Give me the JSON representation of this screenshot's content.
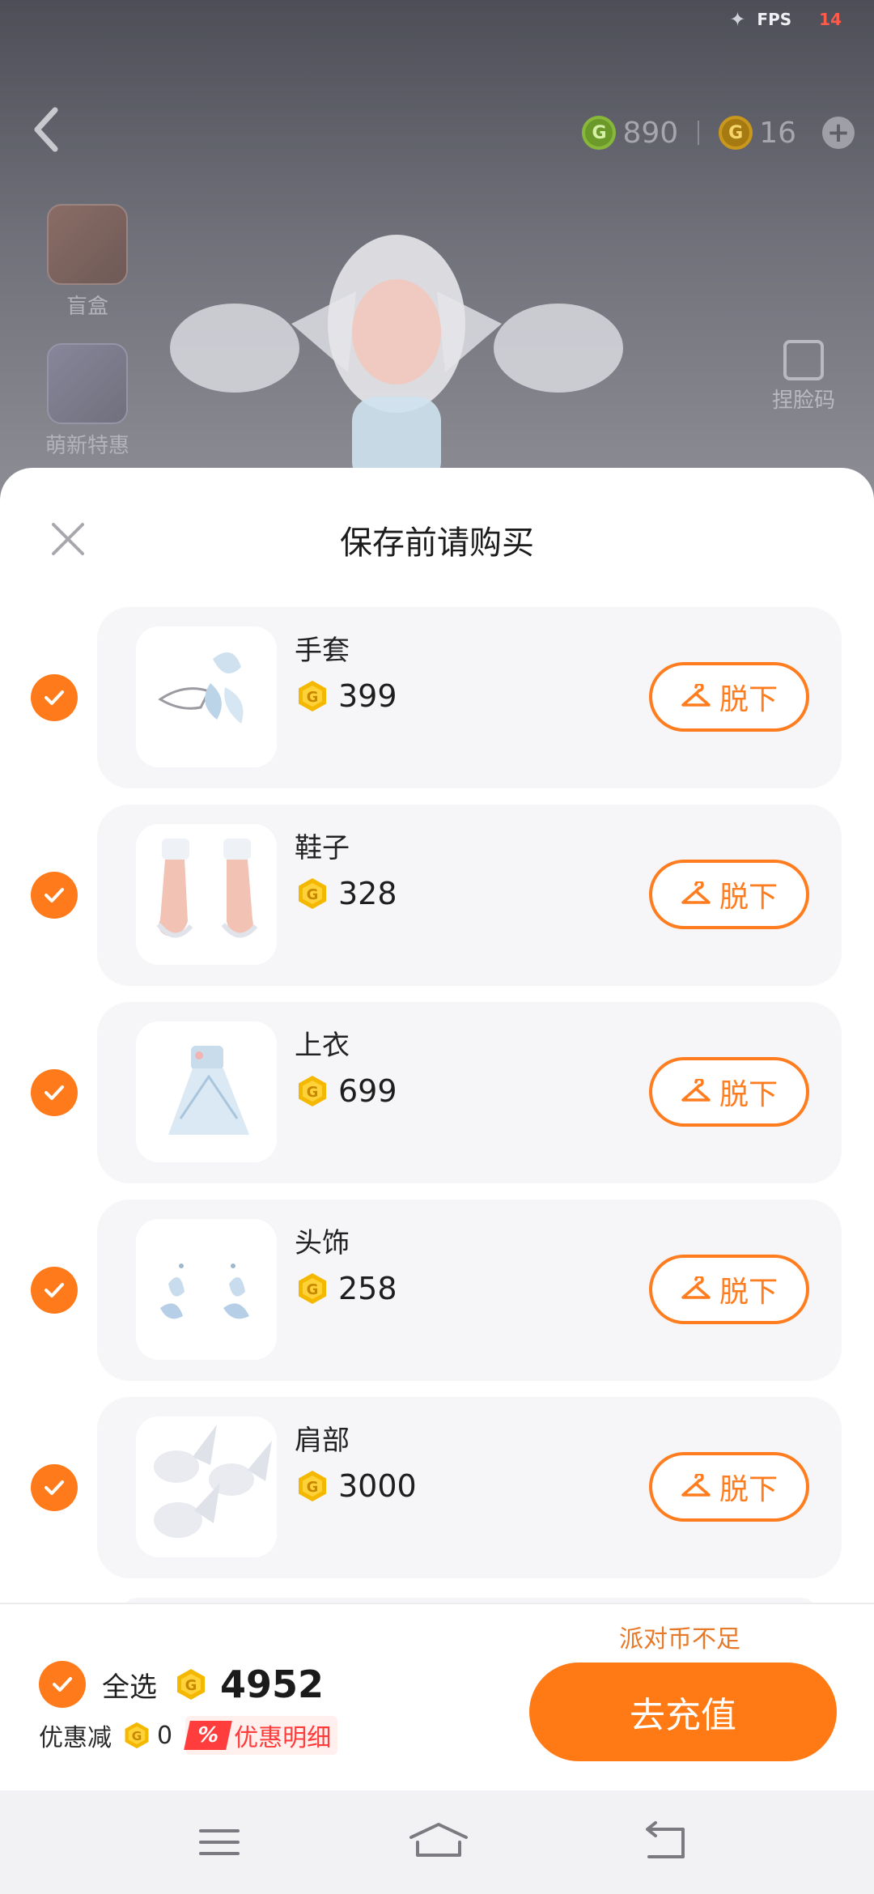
{
  "status": {
    "fps_label": "FPS",
    "fps_value": "14"
  },
  "wallet": {
    "green_coin_glyph": "G",
    "green_amount": "890",
    "gold_coin_glyph": "G",
    "gold_amount": "16"
  },
  "side_menu": [
    {
      "label": "盲盒"
    },
    {
      "label": "萌新特惠"
    }
  ],
  "right_tools": {
    "face_code": "捏脸码"
  },
  "sheet": {
    "title": "保存前请购买",
    "remove_label": "脱下",
    "items": [
      {
        "name": "手套",
        "price": "399",
        "checked": true
      },
      {
        "name": "鞋子",
        "price": "328",
        "checked": true
      },
      {
        "name": "上衣",
        "price": "699",
        "checked": true
      },
      {
        "name": "头饰",
        "price": "258",
        "checked": true
      },
      {
        "name": "肩部",
        "price": "3000",
        "checked": true
      }
    ]
  },
  "footer": {
    "warning": "派对币不足",
    "select_all_label": "全选",
    "total": "4952",
    "discount_label": "优惠减",
    "discount_amount": "0",
    "discount_badge": "%",
    "discount_detail": "优惠明细",
    "recharge_button": "去充值"
  },
  "colors": {
    "accent": "#ff7a14",
    "coin": "#f5b800",
    "warning": "#e77a2a",
    "discount": "#ff3b3b"
  }
}
